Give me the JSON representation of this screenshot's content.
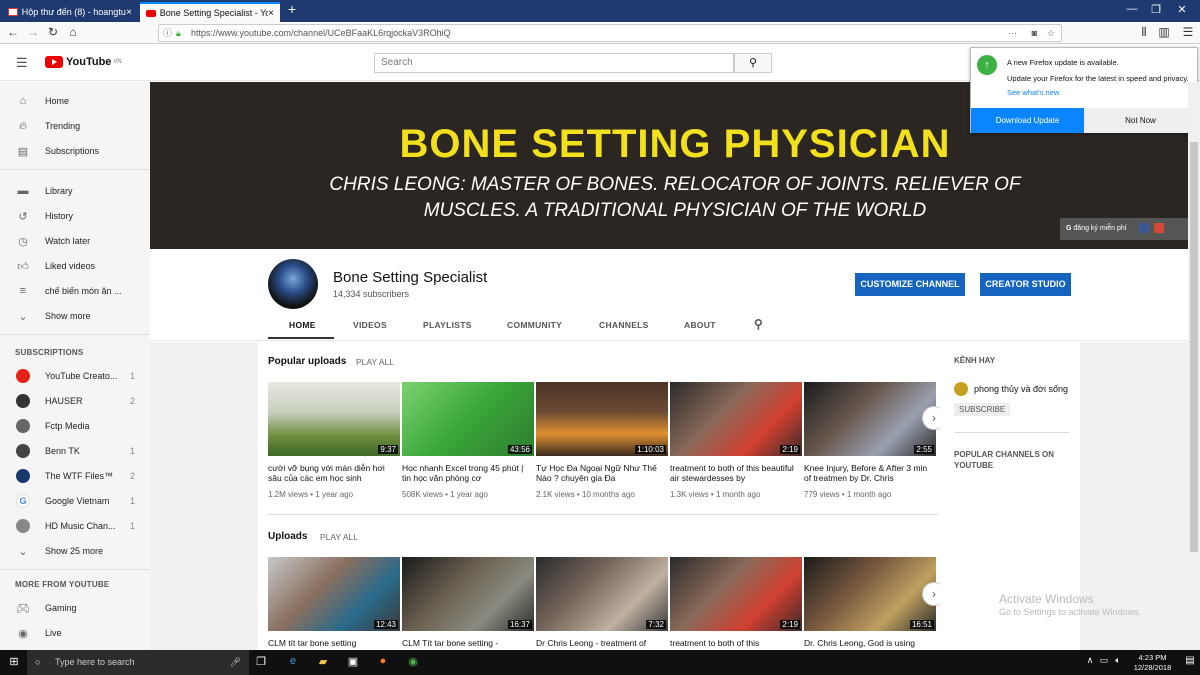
{
  "browser": {
    "tabs": [
      {
        "label": "Hộp thư đến (8) - hoangtuhcvp",
        "active": false
      },
      {
        "label": "Bone Setting Specialist - YouTu",
        "active": true
      }
    ],
    "url": "https://www.youtube.com/channel/UCeBFaaKL6rqjockaV3ROhiQ",
    "url_domain": "www.youtube.com",
    "new_tab": "+",
    "close": "×",
    "url_actions": "···"
  },
  "firefox_update": {
    "title": "A new Firefox update is available.",
    "body": "Update your Firefox for the latest in speed and privacy.",
    "link": "See what's new.",
    "primary": "Download Update",
    "secondary": "Not Now"
  },
  "youtube": {
    "logo": "YouTube",
    "region": "VN",
    "search_placeholder": "Search"
  },
  "sidebar": {
    "main": [
      {
        "label": "Home",
        "icon": "home-icon"
      },
      {
        "label": "Trending",
        "icon": "trending-icon"
      },
      {
        "label": "Subscriptions",
        "icon": "subscriptions-icon"
      }
    ],
    "library": [
      {
        "label": "Library",
        "icon": "library-icon"
      },
      {
        "label": "History",
        "icon": "history-icon"
      },
      {
        "label": "Watch later",
        "icon": "watch-later-icon"
      },
      {
        "label": "Liked videos",
        "icon": "liked-icon"
      },
      {
        "label": "chế biến món ăn ...",
        "icon": "playlist-icon"
      },
      {
        "label": "Show more",
        "icon": "chevron-down-icon"
      }
    ],
    "subscriptions_header": "SUBSCRIPTIONS",
    "subscriptions": [
      {
        "label": "YouTube Creato...",
        "count": "1",
        "color": "#e62117"
      },
      {
        "label": "HAUSER",
        "count": "2",
        "color": "#333333"
      },
      {
        "label": "Fctp Media",
        "count": "",
        "color": "#666666"
      },
      {
        "label": "Benn TK",
        "count": "1",
        "color": "#444444"
      },
      {
        "label": "The WTF Files™",
        "count": "2",
        "color": "#1a3a6b"
      },
      {
        "label": "Google Vietnam",
        "count": "1",
        "color": "#4285f4"
      },
      {
        "label": "HD Music Chan...",
        "count": "1",
        "color": "#888888"
      }
    ],
    "show_more_subs": "Show 25 more",
    "more_header": "MORE FROM YOUTUBE",
    "more": [
      {
        "label": "Gaming",
        "icon": "gaming-icon"
      },
      {
        "label": "Live",
        "icon": "live-icon"
      }
    ]
  },
  "banner": {
    "title": "BONE SETTING PHYSICIAN",
    "subtitle": "CHRIS LEONG: MASTER OF BONES. RELOCATOR OF JOINTS. RELIEVER OF MUSCLES. A TRADITIONAL PHYSICIAN OF THE WORLD",
    "links": "đăng ký miễn phí"
  },
  "channel": {
    "name": "Bone Setting Specialist",
    "subscribers": "14,334 subscribers",
    "customize": "CUSTOMIZE CHANNEL",
    "studio": "CREATOR STUDIO",
    "tabs": [
      "HOME",
      "VIDEOS",
      "PLAYLISTS",
      "COMMUNITY",
      "CHANNELS",
      "ABOUT"
    ]
  },
  "popular": {
    "title": "Popular uploads",
    "play_all": "PLAY ALL",
    "videos": [
      {
        "title": "cười vỡ bụng với màn diễn hơi sâu của các em học sinh",
        "views": "1.2M views",
        "age": "1 year ago",
        "duration": "9:37"
      },
      {
        "title": "Học nhanh Excel trong 45 phút | tin học văn phòng cơ",
        "views": "508K views",
        "age": "1 year ago",
        "duration": "43:56"
      },
      {
        "title": "Tự Học Đa Ngoại Ngữ Như Thế Nào ? chuyên gia Đa",
        "views": "2.1K views",
        "age": "10 months ago",
        "duration": "1:10:03"
      },
      {
        "title": "treatment to both of this beautiful air stewardesses by",
        "views": "1.3K views",
        "age": "1 month ago",
        "duration": "2:19"
      },
      {
        "title": "Knee Injury, Before & After 3 min of treatmen by Dr. Chris",
        "views": "779 views",
        "age": "1 month ago",
        "duration": "2:55"
      }
    ]
  },
  "uploads": {
    "title": "Uploads",
    "play_all": "PLAY ALL",
    "videos": [
      {
        "title": "CLM tít tar bone setting",
        "duration": "12:43"
      },
      {
        "title": "CLM Tít tar bone setting -",
        "duration": "16:37"
      },
      {
        "title": "Dr Chris Leong - treatment of",
        "duration": "7:32"
      },
      {
        "title": "treatment to both of this",
        "duration": "2:19"
      },
      {
        "title": "Dr. Chris Leong, God is using",
        "duration": "16:51"
      }
    ]
  },
  "right": {
    "kenh_hay": "KÊNH HAY",
    "channel_name": "phong thủy và đời sống",
    "subscribe": "SUBSCRIBE",
    "popular_header": "POPULAR CHANNELS ON YOUTUBE"
  },
  "taskbar": {
    "search_placeholder": "Type here to search",
    "time": "4:23 PM",
    "date": "12/28/2018"
  },
  "watermark": {
    "line1": "Activate Windows",
    "line2": "Go to Settings to activate Windows."
  }
}
